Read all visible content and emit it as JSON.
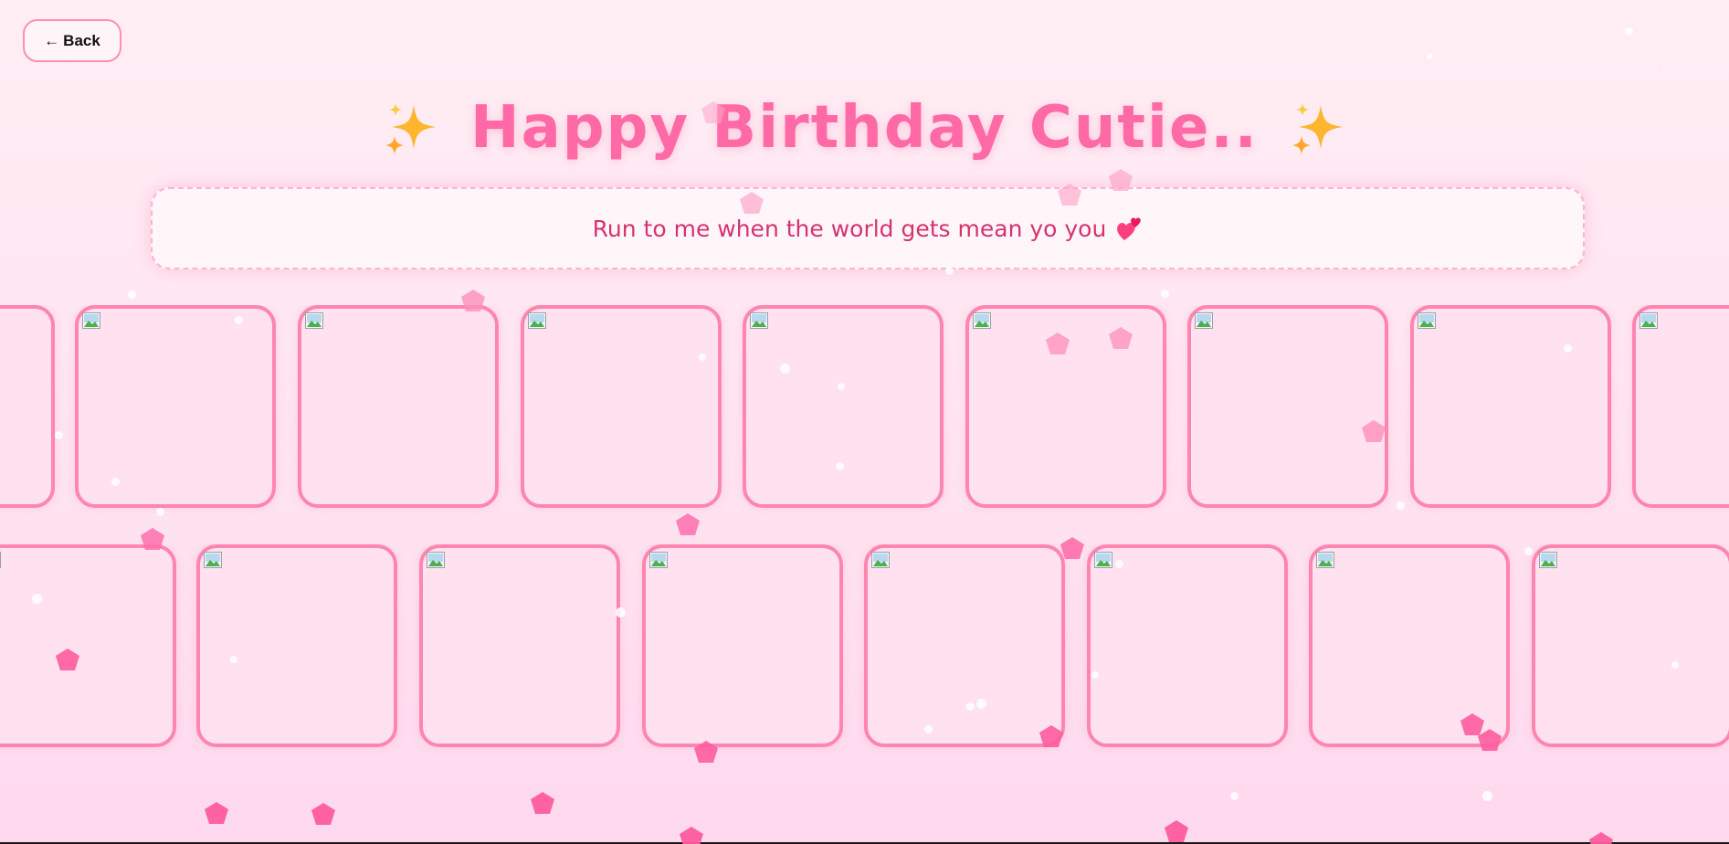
{
  "back_button": {
    "arrow": "←",
    "label": "Back"
  },
  "title": {
    "text": "Happy Birthday Cutie..",
    "left_icon": "sparkles-icon",
    "right_icon": "sparkles-icon"
  },
  "message": {
    "text": "Run to me when the world gets mean yo you",
    "icon": "two-hearts-icon"
  },
  "gallery": {
    "row1_count": 9,
    "row2_count": 8,
    "image_placeholder_icon": "broken-image-icon"
  },
  "colors": {
    "accent_pink": "#ff6aa6",
    "card_border": "#ff85b1",
    "message_text": "#d6336c",
    "petal": "#ff5c9e",
    "sparkle": "#ffb52e"
  }
}
